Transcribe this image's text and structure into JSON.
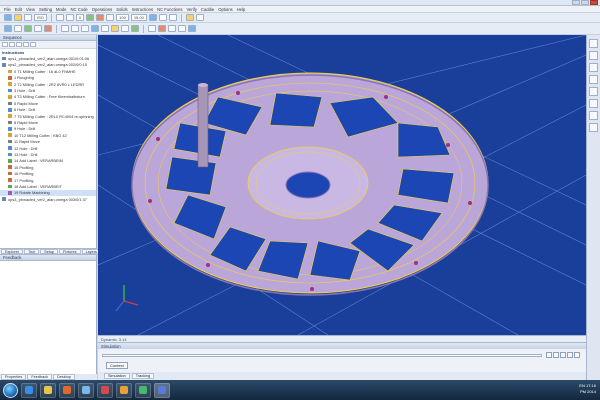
{
  "window": {
    "title": ""
  },
  "menu": [
    "File",
    "Edit",
    "View",
    "Setting",
    "Mode",
    "NC Code",
    "Operations",
    "Solids",
    "Instructions",
    "NC Functions",
    "Verify",
    "Caddie",
    "Options",
    "Help"
  ],
  "toolbar": {
    "select1": "ISO",
    "select2": "0",
    "select3": "100",
    "select4": "15.00"
  },
  "sequence": {
    "title": "Sequence",
    "subtitle": "Instructions",
    "items": [
      "ops1_pinnacled_ver2_alan.omega 001/0:01:06",
      "ops2_pinnacled_ver2_alan.omega 002/0/0:15",
      "0 T1 Milling Cutter : 16 dL0 FNMHE",
      "1 Roughing",
      "2 T2 Milling Cutter : 2R2 6VR0 L LEDRR",
      "3 Hole : Drill",
      "4 T3 Milling Cutter : Free Kleemhalbsturn",
      "5 Rapid Move",
      "6 Hole : Drill",
      "7 T5 Milling Cutter : 2RL0 RC4004 re-spinning",
      "8 Rapid Move",
      "9 Hole : Drill",
      "10 T12 Milling Cutter : KBG 42",
      "11 Rapid Move",
      "12 Hole : Drill",
      "13 Hole : Drill",
      "14 Add Label : VERARBEIM",
      "15 Profiling",
      "16 Profiling",
      "17 Profiling",
      "18 Add Label : VERARBEIT",
      "19 Rotate Machining",
      "ops3_pinnacled_ver2_alan.omega 003/0/1:37"
    ],
    "tabs": [
      "Explorer",
      "Tool",
      "Setup",
      "Fixtures",
      "Layers"
    ]
  },
  "feedback": {
    "title": "Feedback"
  },
  "left_bottom_tabs": [
    "Properties",
    "Feedback",
    "Desktop"
  ],
  "viewport": {
    "status": "Dynamic: 3.14"
  },
  "simulation": {
    "title": "Simulation",
    "context_button": "Context",
    "tabs": [
      "Simulation",
      "Tracking"
    ]
  },
  "taskbar": {
    "time": "17:16",
    "date": "PM 2014",
    "lang": "EN"
  },
  "colors": {
    "viewport_bg": "#1a3f9b",
    "part": "#bba6d9",
    "toolpath": "#f2d23a",
    "pocket": "#1b46b4"
  }
}
